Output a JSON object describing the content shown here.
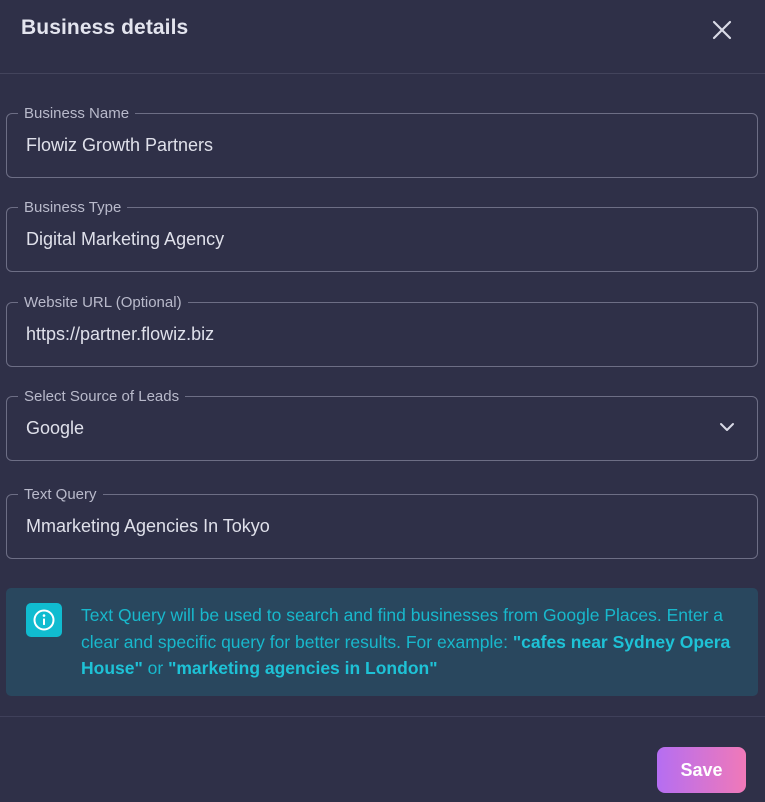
{
  "dialog": {
    "title": "Business details",
    "close_icon": "close-icon"
  },
  "fields": [
    {
      "label": "Business Name",
      "value": "Flowiz Growth Partners"
    },
    {
      "label": "Business Type",
      "value": "Digital Marketing Agency"
    },
    {
      "label": "Website URL (Optional)",
      "value": "https://partner.flowiz.biz"
    },
    {
      "label": "Select Source of Leads",
      "value": "Google",
      "icon": "chevron-down-icon"
    },
    {
      "label": "Text Query",
      "value": "Mmarketing Agencies In Tokyo"
    }
  ],
  "info": {
    "icon": "info-icon",
    "text_part1": "Text Query will be used to search and find businesses from Google Places. Enter a clear and specific query for better results. For example: ",
    "example1": "\"cafes near Sydney Opera House\"",
    "text_part2": " or ",
    "example2": "\"marketing agencies in London\"",
    "accent_color": "#18b8cc"
  },
  "footer": {
    "save_label": "Save"
  },
  "colors": {
    "background": "#2f3048",
    "save_gradient_start": "#b56ef2",
    "save_gradient_end": "#f079b8"
  }
}
